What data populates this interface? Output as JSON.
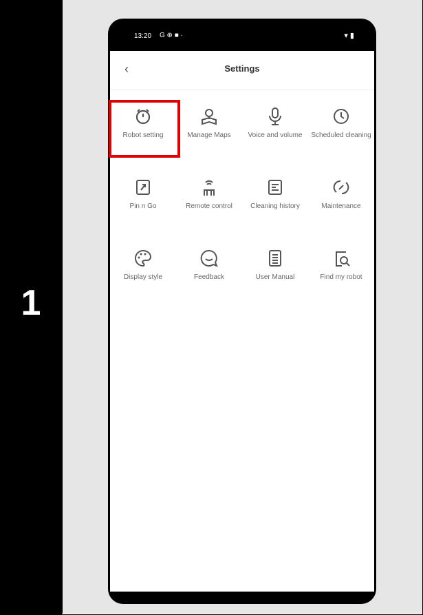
{
  "step": {
    "number": "1"
  },
  "status_bar": {
    "time": "13:20",
    "indicators": "G ⊕ ■ ·",
    "right": "▾ ▮"
  },
  "header": {
    "title": "Settings",
    "back_icon": "chevron-left-icon"
  },
  "highlight": {
    "target": "robot-setting",
    "color": "#e00000"
  },
  "grid": [
    {
      "key": "robot-setting",
      "label": "Robot setting",
      "icon": "robot-clock-icon"
    },
    {
      "key": "manage-maps",
      "label": "Manage Maps",
      "icon": "map-pin-icon"
    },
    {
      "key": "voice-volume",
      "label": "Voice and volume",
      "icon": "microphone-icon"
    },
    {
      "key": "scheduled-cleaning",
      "label": "Scheduled cleaning",
      "icon": "clock-icon"
    },
    {
      "key": "pin-n-go",
      "label": "Pin n Go",
      "icon": "pin-n-go-icon"
    },
    {
      "key": "remote-control",
      "label": "Remote control",
      "icon": "remote-icon"
    },
    {
      "key": "cleaning-history",
      "label": "Cleaning history",
      "icon": "history-icon"
    },
    {
      "key": "maintenance",
      "label": "Maintenance",
      "icon": "wrench-icon"
    },
    {
      "key": "display-style",
      "label": "Display style",
      "icon": "palette-icon"
    },
    {
      "key": "feedback",
      "label": "Feedback",
      "icon": "chat-bubble-icon"
    },
    {
      "key": "user-manual",
      "label": "User Manual",
      "icon": "document-icon"
    },
    {
      "key": "find-my-robot",
      "label": "Find my robot",
      "icon": "search-doc-icon"
    }
  ]
}
